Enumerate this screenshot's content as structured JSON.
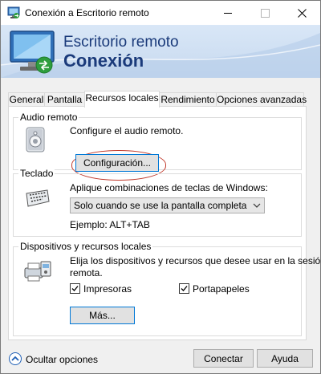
{
  "window": {
    "title": "Conexión a Escritorio remoto"
  },
  "banner": {
    "line1": "Escritorio remoto",
    "line2": "Conexión"
  },
  "tabs": [
    {
      "label": "General"
    },
    {
      "label": "Pantalla"
    },
    {
      "label": "Recursos locales",
      "active": true
    },
    {
      "label": "Rendimiento"
    },
    {
      "label": "Opciones avanzadas"
    }
  ],
  "audio": {
    "group_label": "Audio remoto",
    "description": "Configure el audio remoto.",
    "config_button": "Configuración..."
  },
  "keyboard": {
    "group_label": "Teclado",
    "description": "Aplique combinaciones de teclas de Windows:",
    "selected_option": "Solo cuando se use la pantalla completa",
    "example": "Ejemplo: ALT+TAB"
  },
  "devices": {
    "group_label": "Dispositivos y recursos locales",
    "description_line1": "Elija los dispositivos y recursos que desee usar en la sesión",
    "description_line2": "remota.",
    "printers_label": "Impresoras",
    "printers_checked": true,
    "clipboard_label": "Portapapeles",
    "clipboard_checked": true,
    "more_button": "Más..."
  },
  "footer": {
    "toggle_label": "Ocultar opciones",
    "connect_button": "Conectar",
    "help_button": "Ayuda"
  },
  "colors": {
    "accent": "#0078d7",
    "banner_text": "#1a3a7a",
    "highlight_ring": "#c0392b"
  }
}
